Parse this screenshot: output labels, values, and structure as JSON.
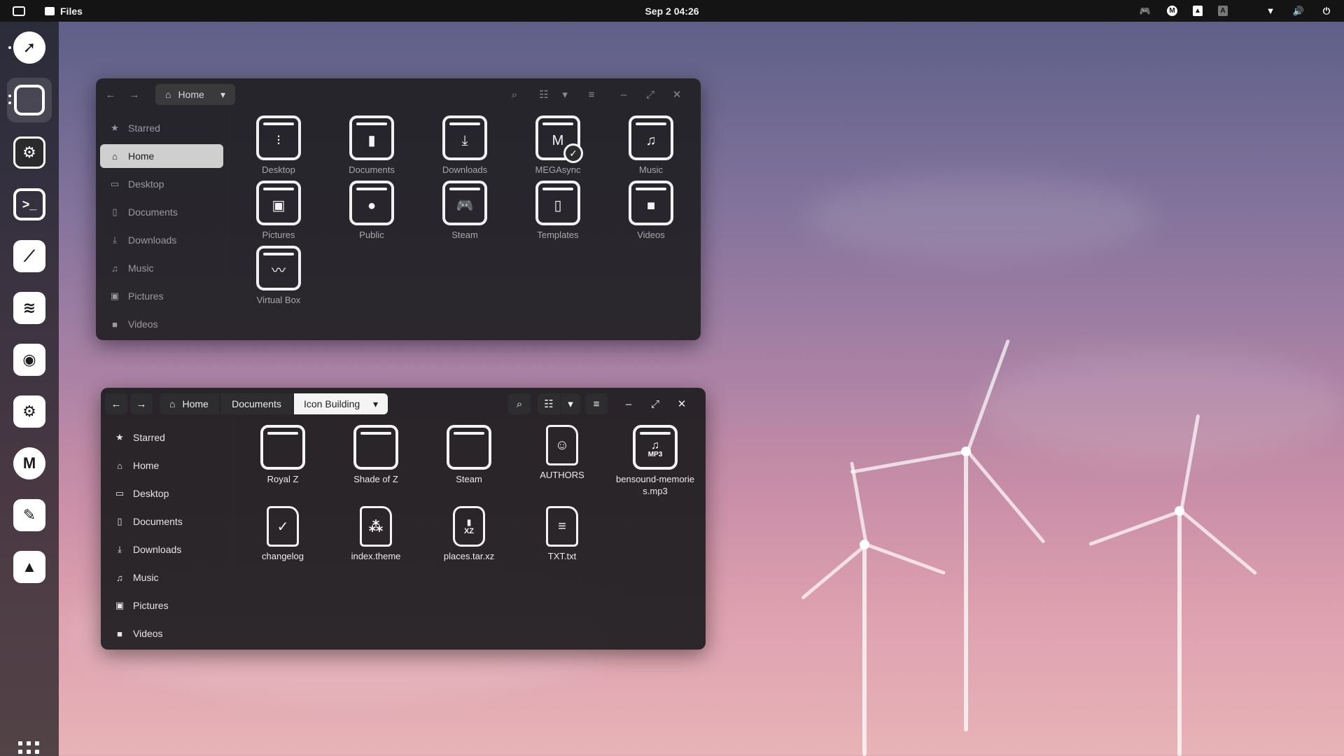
{
  "topbar": {
    "app_name": "Files",
    "clock": "Sep 2  04:26"
  },
  "dock": {
    "items": [
      "compass-icon",
      "window-icon",
      "tweaks-icon",
      "terminal-icon",
      "kdenlive-icon",
      "rss-icon",
      "speaker-icon",
      "steam-icon",
      "megasync-icon",
      "brush-icon",
      "inkscape-icon"
    ]
  },
  "window1": {
    "path": [
      "Home"
    ],
    "sidebar": [
      {
        "label": "Starred",
        "icon": "★"
      },
      {
        "label": "Home",
        "icon": "⌂"
      },
      {
        "label": "Desktop",
        "icon": "▭"
      },
      {
        "label": "Documents",
        "icon": "▯"
      },
      {
        "label": "Downloads",
        "icon": "⤓"
      },
      {
        "label": "Music",
        "icon": "♫"
      },
      {
        "label": "Pictures",
        "icon": "▣"
      },
      {
        "label": "Videos",
        "icon": "■"
      }
    ],
    "items": [
      {
        "label": "Desktop"
      },
      {
        "label": "Documents"
      },
      {
        "label": "Downloads"
      },
      {
        "label": "MEGAsync"
      },
      {
        "label": "Music"
      },
      {
        "label": "Pictures"
      },
      {
        "label": "Public"
      },
      {
        "label": "Steam"
      },
      {
        "label": "Templates"
      },
      {
        "label": "Videos"
      },
      {
        "label": "Virtual Box"
      }
    ]
  },
  "window2": {
    "path": [
      "Home",
      "Documents",
      "Icon Building"
    ],
    "sidebar": [
      {
        "label": "Starred",
        "icon": "★"
      },
      {
        "label": "Home",
        "icon": "⌂"
      },
      {
        "label": "Desktop",
        "icon": "▭"
      },
      {
        "label": "Documents",
        "icon": "▯"
      },
      {
        "label": "Downloads",
        "icon": "⤓"
      },
      {
        "label": "Music",
        "icon": "♫"
      },
      {
        "label": "Pictures",
        "icon": "▣"
      },
      {
        "label": "Videos",
        "icon": "■"
      }
    ],
    "items": [
      {
        "label": "Royal Z"
      },
      {
        "label": "Shade of Z"
      },
      {
        "label": "Steam"
      },
      {
        "label": "AUTHORS"
      },
      {
        "label": "bensound-memories.mp3"
      },
      {
        "label": "changelog"
      },
      {
        "label": "index.theme"
      },
      {
        "label": "places.tar.xz"
      },
      {
        "label": "TXT.txt"
      }
    ],
    "mp3_badge": "MP3",
    "xz_badge": "XZ"
  }
}
